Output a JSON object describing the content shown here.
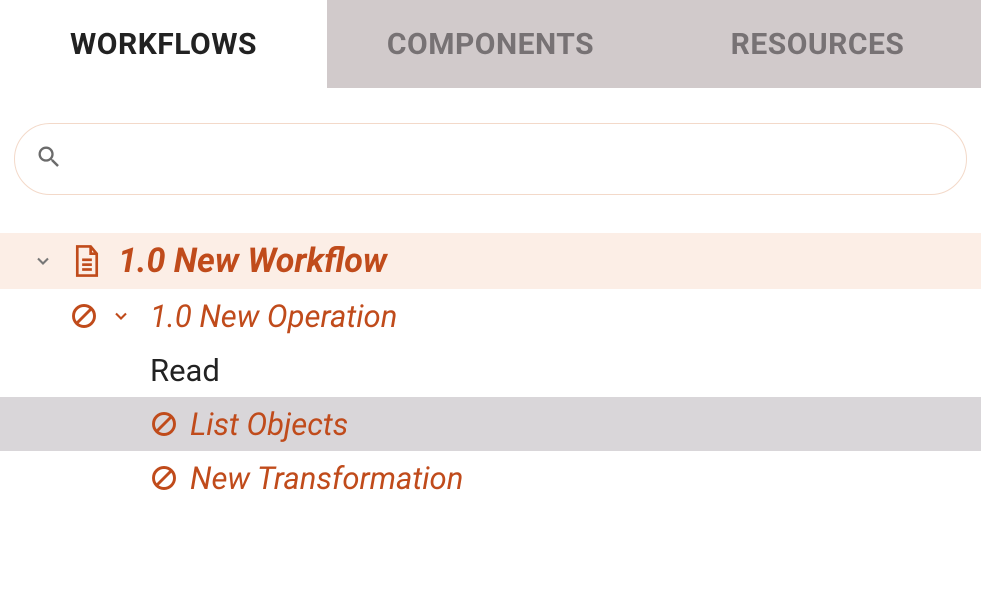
{
  "tabs": {
    "workflows": "WORKFLOWS",
    "components": "COMPONENTS",
    "resources": "RESOURCES",
    "active": "workflows"
  },
  "search": {
    "value": "",
    "placeholder": ""
  },
  "tree": {
    "workflow": {
      "label": "1.0 New Workflow"
    },
    "operation": {
      "label": "1.0 New Operation"
    },
    "read": {
      "label": "Read"
    },
    "listObjects": {
      "label": "List Objects"
    },
    "newTransformation": {
      "label": "New Transformation"
    }
  },
  "colors": {
    "accent": "#c04b1b",
    "activeTabBg": "#ffffff",
    "inactiveTabBg": "#d1cacb",
    "highlightRowBg": "#fceee6",
    "selectedRowBg": "#d9d6d9"
  }
}
